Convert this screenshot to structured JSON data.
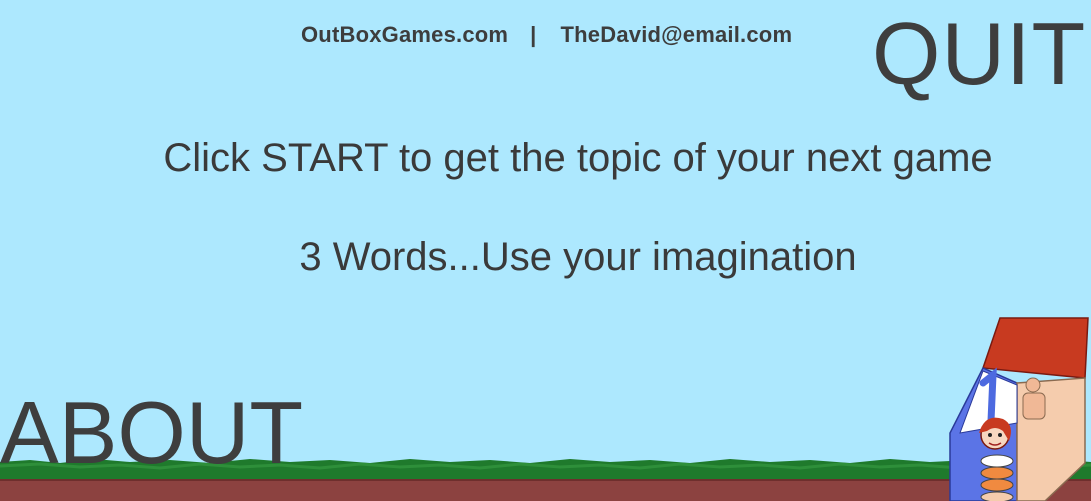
{
  "header": {
    "website": "OutBoxGames.com",
    "separator": "|",
    "email": "TheDavid@email.com"
  },
  "buttons": {
    "quit_label": "QUIT",
    "about_label": "ABOUT"
  },
  "instructions": {
    "line1": "Click START to get the topic of your next game",
    "line2": "3 Words...Use your imagination"
  },
  "colors": {
    "sky": "#ade8fe",
    "grass": "#1f7a2c",
    "dirt": "#8c4240",
    "text": "#3a3a3a"
  },
  "icons": {
    "mascot": "dice-character-icon"
  }
}
